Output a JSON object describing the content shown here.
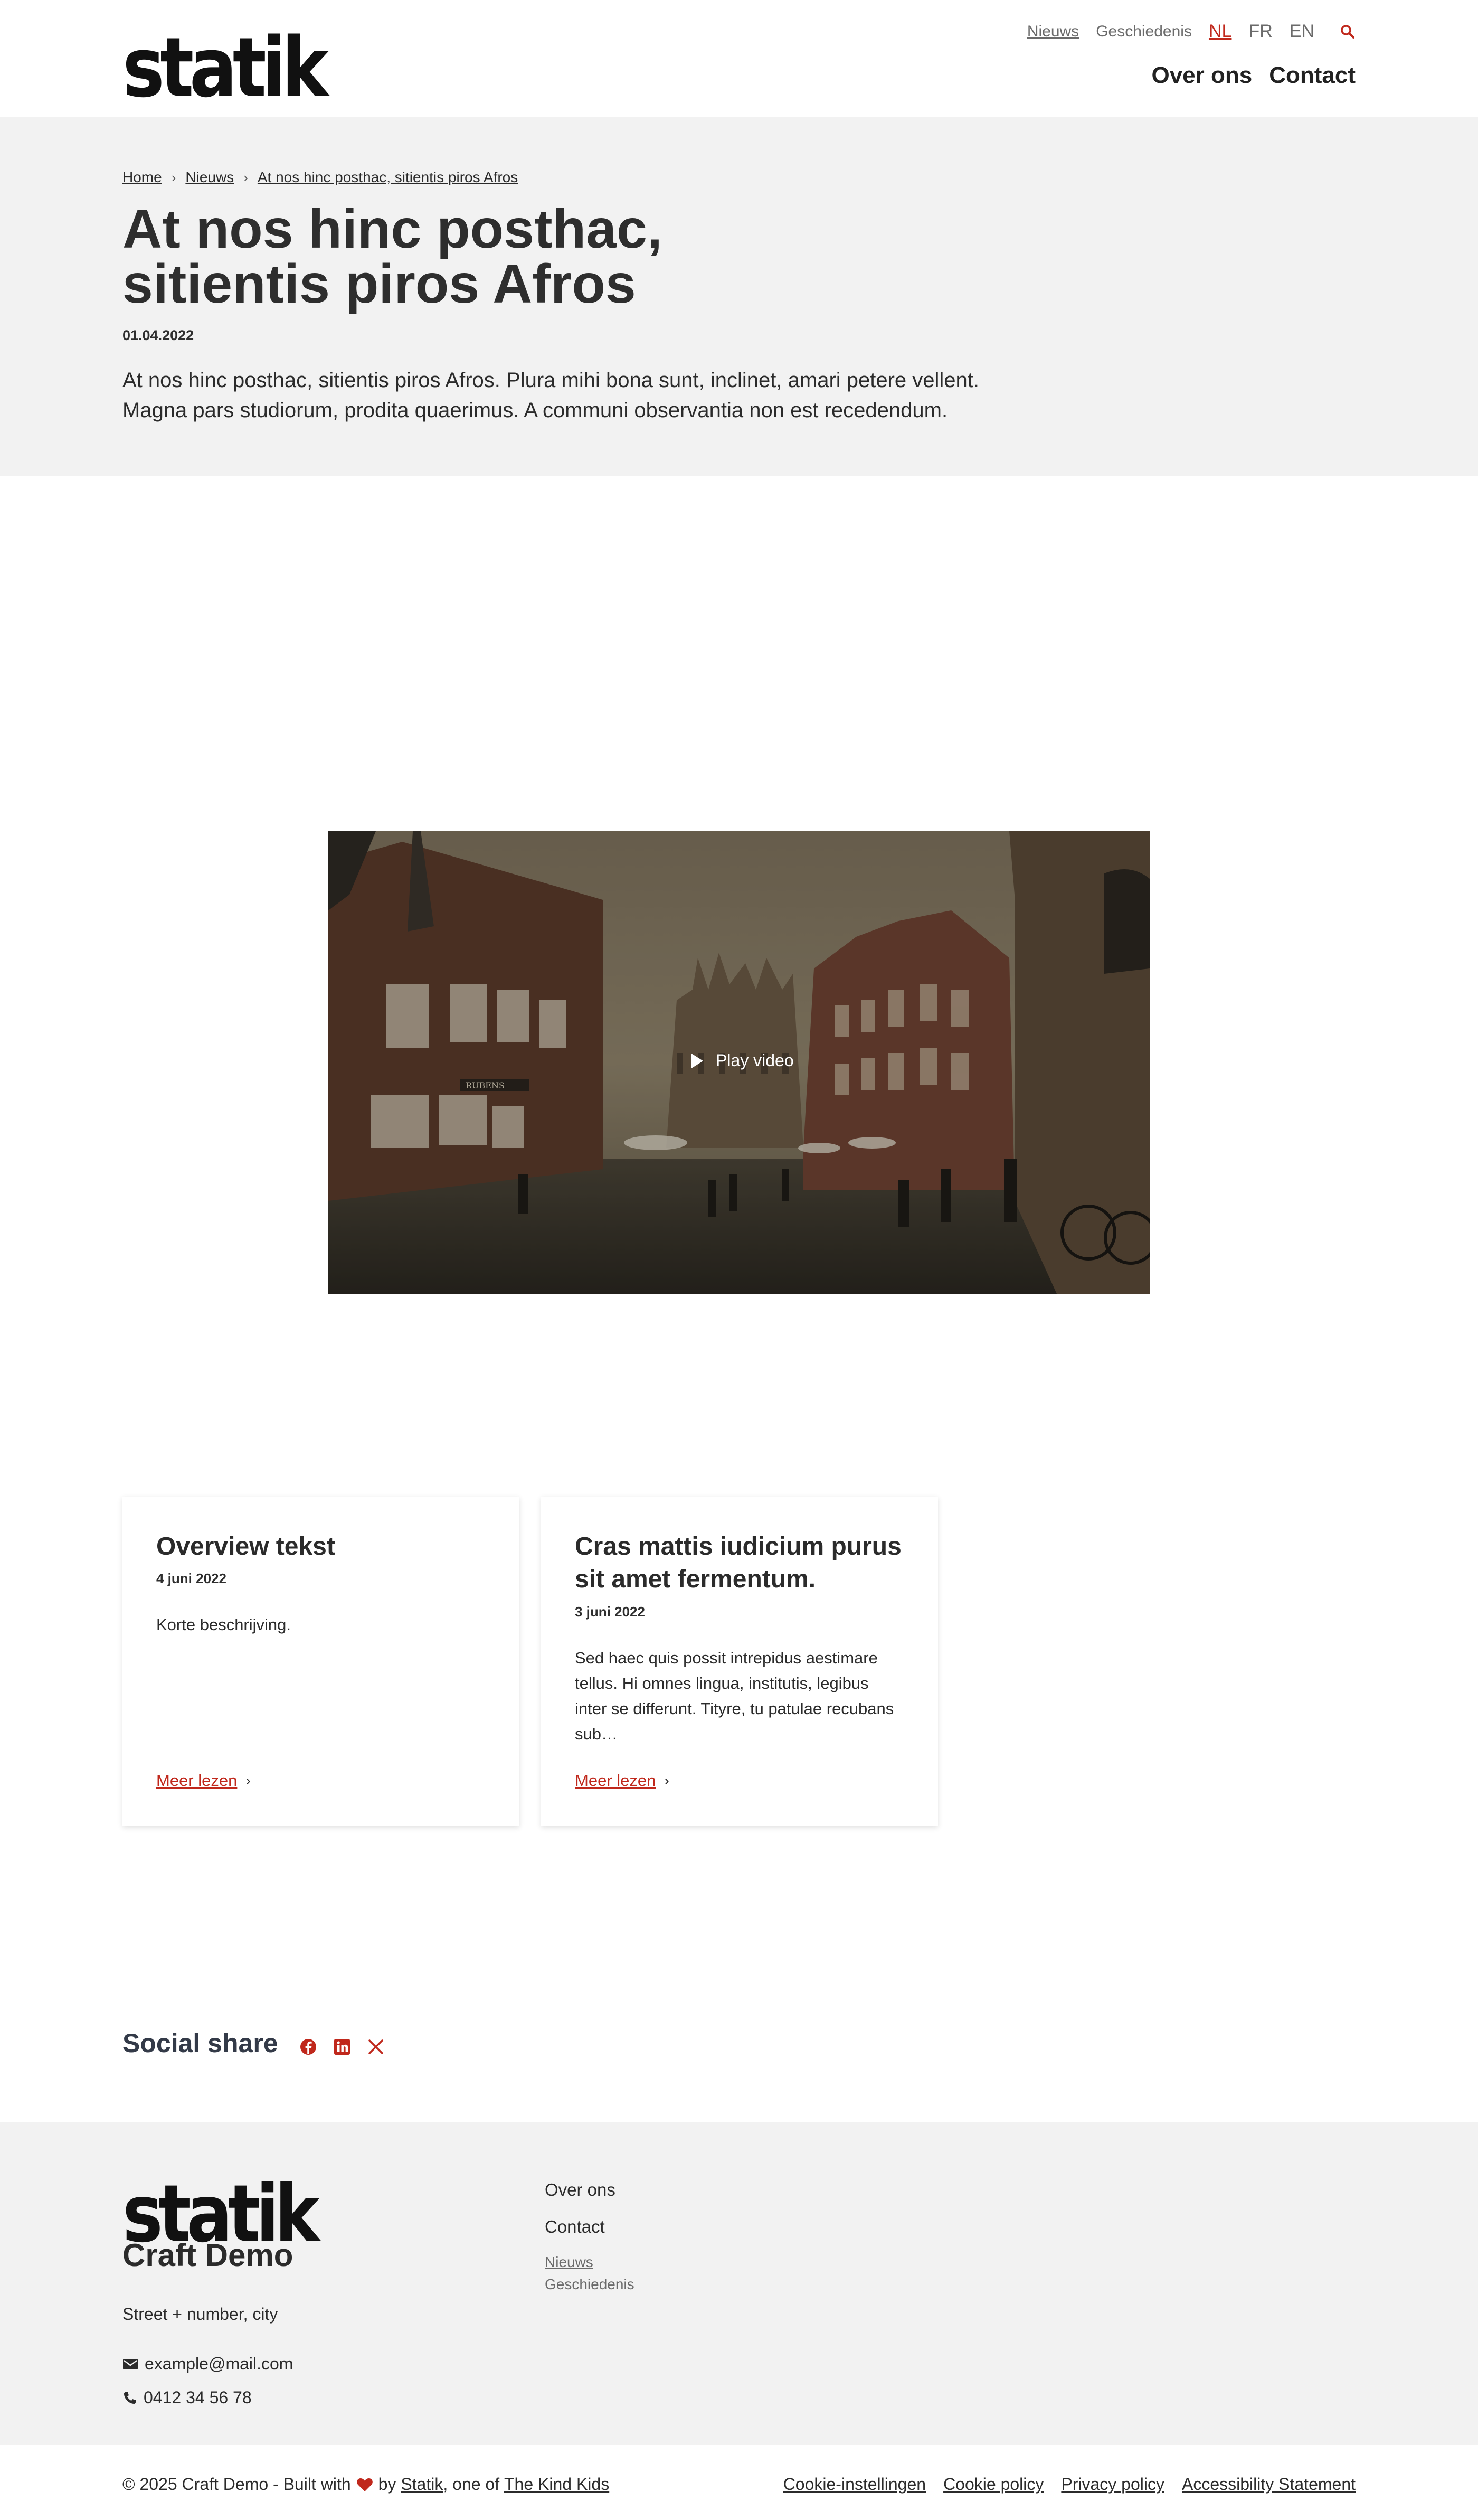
{
  "header": {
    "logo_text": "statik",
    "utility_nav": [
      "Nieuws",
      "Geschiedenis"
    ],
    "languages": [
      "NL",
      "FR",
      "EN"
    ],
    "active_language": "NL",
    "main_nav": [
      "Over ons",
      "Contact"
    ],
    "search_icon": "search-icon"
  },
  "hero": {
    "breadcrumb": [
      "Home",
      "Nieuws",
      "At nos hinc posthac, sitientis piros Afros"
    ],
    "title_line1": "At nos hinc posthac,",
    "title_line2": "sitientis piros Afros",
    "date": "01.04.2022",
    "intro_line1": "At nos hinc posthac, sitientis piros Afros. Plura mihi bona sunt, inclinet, amari petere vellent.",
    "intro_line2": "Magna pars studiorum, prodita quaerimus. A communi observantia non est recedendum."
  },
  "video": {
    "play_label": "Play video",
    "sign_text": "RUBENS"
  },
  "cards": [
    {
      "title": "Overview tekst",
      "date": "4 juni 2022",
      "description": "Korte beschrijving.",
      "link_label": "Meer lezen"
    },
    {
      "title": "Cras mattis iudicium purus sit amet fermentum.",
      "date": "3 juni 2022",
      "description": "Sed haec quis possit intrepidus aestimare tellus. Hi omnes lingua, institutis, legibus inter se differunt. Tityre, tu patulae recubans sub…",
      "link_label": "Meer lezen"
    }
  ],
  "social": {
    "title": "Social share",
    "icons": [
      "facebook-icon",
      "linkedin-icon",
      "x-icon"
    ]
  },
  "footer": {
    "logo_text": "statik",
    "site_name": "Craft Demo",
    "address": "Street + number, city",
    "email": "example@mail.com",
    "phone": "0412 34 56 78",
    "nav_main": [
      "Over ons",
      "Contact"
    ],
    "nav_secondary": [
      "Nieuws",
      "Geschiedenis"
    ]
  },
  "bottom": {
    "copyright_prefix": "© 2025 Craft Demo - Built with",
    "by": "by",
    "statik_link": "Statik",
    "one_of": ", one of",
    "kind_kids_link": "The Kind Kids",
    "legal_links": [
      "Cookie-instellingen",
      "Cookie policy",
      "Privacy policy",
      "Accessibility Statement"
    ]
  },
  "colors": {
    "accent": "#c0281c",
    "hero_bg": "#f2f2f2",
    "text": "#2b2b2b"
  }
}
